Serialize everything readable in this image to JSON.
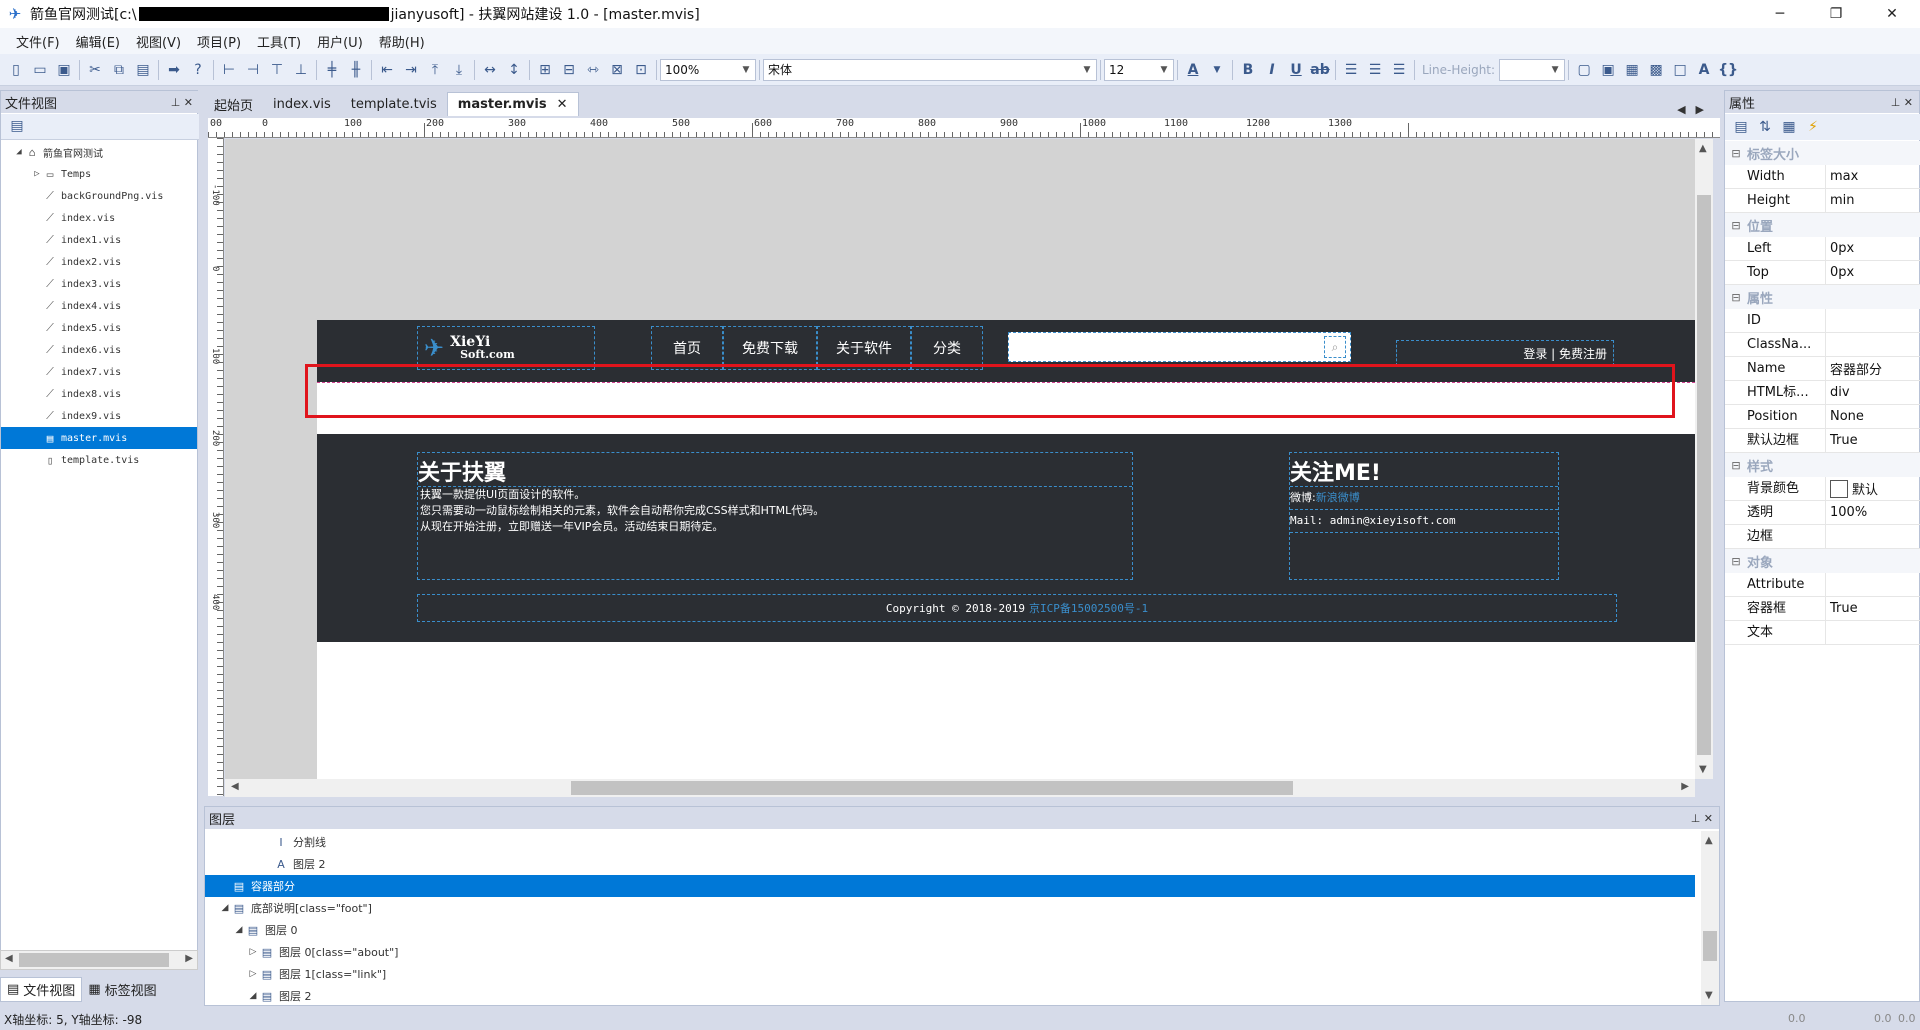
{
  "window": {
    "title_prefix": "箭鱼官网测试[c:\\",
    "title_suffix": "jianyusoft] - 扶翼网站建设 1.0 - [master.mvis]",
    "minimize": "─",
    "restore": "❐",
    "close": "✕"
  },
  "menu": [
    "文件(F)",
    "编辑(E)",
    "视图(V)",
    "项目(P)",
    "工具(T)",
    "用户(U)",
    "帮助(H)"
  ],
  "toolbar": {
    "zoom": "100%",
    "font": "宋体",
    "size": "12",
    "lineheight_label": "Line-Height:",
    "lineheight_value": ""
  },
  "left_panel": {
    "title": "文件视图",
    "tree": [
      {
        "label": "箭鱼官网测试",
        "level": 0,
        "icon": "project-icon",
        "expander": "◢"
      },
      {
        "label": "Temps",
        "level": 1,
        "icon": "folder-icon",
        "expander": "▷"
      },
      {
        "label": "backGroundPng.vis",
        "level": 1,
        "icon": "vis-file-icon"
      },
      {
        "label": "index.vis",
        "level": 1,
        "icon": "vis-file-icon"
      },
      {
        "label": "index1.vis",
        "level": 1,
        "icon": "vis-file-icon"
      },
      {
        "label": "index2.vis",
        "level": 1,
        "icon": "vis-file-icon"
      },
      {
        "label": "index3.vis",
        "level": 1,
        "icon": "vis-file-icon"
      },
      {
        "label": "index4.vis",
        "level": 1,
        "icon": "vis-file-icon"
      },
      {
        "label": "index5.vis",
        "level": 1,
        "icon": "vis-file-icon"
      },
      {
        "label": "index6.vis",
        "level": 1,
        "icon": "vis-file-icon"
      },
      {
        "label": "index7.vis",
        "level": 1,
        "icon": "vis-file-icon"
      },
      {
        "label": "index8.vis",
        "level": 1,
        "icon": "vis-file-icon"
      },
      {
        "label": "index9.vis",
        "level": 1,
        "icon": "vis-file-icon"
      },
      {
        "label": "master.mvis",
        "level": 1,
        "icon": "mvis-file-icon",
        "selected": true
      },
      {
        "label": "template.tvis",
        "level": 1,
        "icon": "tvis-file-icon"
      }
    ],
    "tabs": [
      "文件视图",
      "标签视图"
    ]
  },
  "doc_tabs": [
    "起始页",
    "index.vis",
    "template.tvis",
    "master.mvis"
  ],
  "active_doc_tab": "master.mvis",
  "ruler": {
    "h_labels": [
      "00",
      "0",
      "100",
      "200",
      "300",
      "400",
      "500",
      "600",
      "700",
      "800",
      "900",
      "1000",
      "1100",
      "1200",
      "1300"
    ],
    "v_labels": [
      "-100",
      "0",
      "100",
      "200",
      "300",
      "400"
    ]
  },
  "page": {
    "logo_line1": "XieYi",
    "logo_line2": "Soft.com",
    "nav": [
      "首页",
      "免费下载",
      "关于软件",
      "分类"
    ],
    "login": "登录 | 免费注册",
    "about_title": "关于扶翼",
    "about_lines": [
      "扶翼一款提供UI页面设计的软件。",
      "您只需要动一动鼠标绘制相关的元素，软件会自动帮你完成CSS样式和HTML代码。",
      "从现在开始注册，立即赠送一年VIP会员。活动结束日期待定。"
    ],
    "follow_title": "关注ME!",
    "weibo_label": "微博:",
    "weibo_link": "新浪微博",
    "mail": "Mail: admin@xieyisoft.com",
    "copyright": "Copyright © 2018-2019",
    "icp": "京ICP备15002500号-1"
  },
  "layers": {
    "title": "图层",
    "rows": [
      {
        "label": "分割线",
        "indent": 4,
        "icon": "I"
      },
      {
        "label": "图层 2",
        "indent": 4,
        "icon": "A"
      },
      {
        "label": "容器部分",
        "indent": 1,
        "icon": "▤",
        "selected": true
      },
      {
        "label": "底部说明[class=\"foot\"]",
        "indent": 1,
        "icon": "▤",
        "expander": "◢"
      },
      {
        "label": "图层 0",
        "indent": 2,
        "icon": "▤",
        "expander": "◢"
      },
      {
        "label": "图层 0[class=\"about\"]",
        "indent": 3,
        "icon": "▤",
        "expander": "▷"
      },
      {
        "label": "图层 1[class=\"link\"]",
        "indent": 3,
        "icon": "▤",
        "expander": "▷"
      },
      {
        "label": "图层 2",
        "indent": 3,
        "icon": "▤",
        "expander": "◢"
      }
    ]
  },
  "properties": {
    "title": "属性",
    "categories": [
      {
        "name": "标签大小",
        "rows": [
          [
            "Width",
            "max"
          ],
          [
            "Height",
            "min"
          ]
        ]
      },
      {
        "name": "位置",
        "rows": [
          [
            "Left",
            "0px"
          ],
          [
            "Top",
            "0px"
          ]
        ]
      },
      {
        "name": "属性",
        "rows": [
          [
            "ID",
            ""
          ],
          [
            "ClassNa...",
            ""
          ],
          [
            "Name",
            "容器部分"
          ],
          [
            "HTML标...",
            "div"
          ],
          [
            "Position",
            "None"
          ],
          [
            "默认边框",
            "True"
          ]
        ]
      },
      {
        "name": "样式",
        "rows": [
          [
            "背景颜色",
            "默认"
          ],
          [
            "透明",
            "100%"
          ],
          [
            "边框",
            ""
          ]
        ]
      },
      {
        "name": "对象",
        "rows": [
          [
            "Attribute",
            ""
          ],
          [
            "容器框",
            "True"
          ],
          [
            "文本",
            ""
          ]
        ]
      }
    ]
  },
  "status": {
    "coords": "X轴坐标: 5, Y轴坐标: -98",
    "right1": "0.0",
    "right2": "0.0",
    "right3": "0.0"
  }
}
